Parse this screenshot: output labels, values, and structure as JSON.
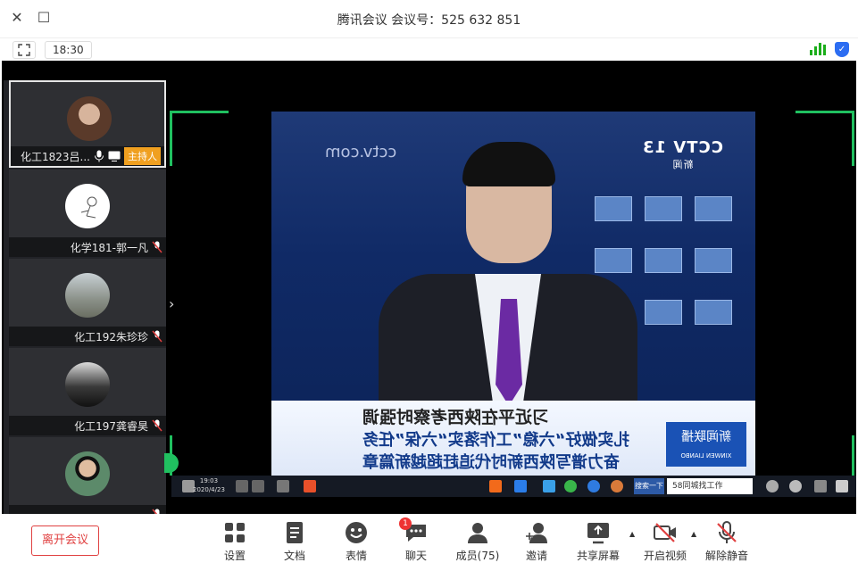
{
  "window": {
    "title": "腾讯会议 会议号：525 632 851",
    "close_glyph": "✕",
    "maximize_glyph": "☐"
  },
  "toolbar": {
    "timer": "18:30"
  },
  "participants": [
    {
      "name": "化工1823吕...",
      "role_badge": "主持人",
      "mic": "on",
      "active": true,
      "avatar": "woman-portrait"
    },
    {
      "name": "化学181-郭一凡",
      "mic": "muted",
      "active": false,
      "avatar": "sketch-figure"
    },
    {
      "name": "化工192朱珍珍",
      "mic": "muted",
      "active": false,
      "avatar": "landscape-photo"
    },
    {
      "name": "化工197龚睿昊",
      "mic": "muted",
      "active": false,
      "avatar": "dark-scene"
    },
    {
      "name": "",
      "mic": "muted",
      "active": false,
      "avatar": "young-man"
    }
  ],
  "shared_screen": {
    "channel_logo": "CCTV 13",
    "channel_sub": "新闻",
    "watermark": "cctv.com",
    "caption_lines": [
      "习近平在陕西考察时强调",
      "扎实做好“六稳”工作落实“六保”任务",
      "奋力谱写陕西新时代追赶超越新篇章"
    ],
    "program_brand": "新闻联播",
    "program_brand_en": "XINWEN LIANBO",
    "taskbar": {
      "search_text": "58同城找工作",
      "tab_text": "搜索一下",
      "clock_time": "19:03",
      "clock_date": "2020/4/23"
    }
  },
  "controls": {
    "leave": "离开会议",
    "items": [
      {
        "key": "settings",
        "label": "设置"
      },
      {
        "key": "docs",
        "label": "文档"
      },
      {
        "key": "emoji",
        "label": "表情"
      },
      {
        "key": "chat",
        "label": "聊天",
        "badge": "1"
      },
      {
        "key": "members",
        "label": "成员(75)"
      },
      {
        "key": "invite",
        "label": "邀请"
      },
      {
        "key": "share",
        "label": "共享屏幕"
      },
      {
        "key": "video",
        "label": "开启视频"
      },
      {
        "key": "audio",
        "label": "解除静音"
      }
    ]
  },
  "colors": {
    "accent_green": "#20c060",
    "host_badge": "#f0a020",
    "danger_red": "#e04040",
    "mic_muted": "#e04040",
    "shield_blue": "#2c6df2"
  }
}
